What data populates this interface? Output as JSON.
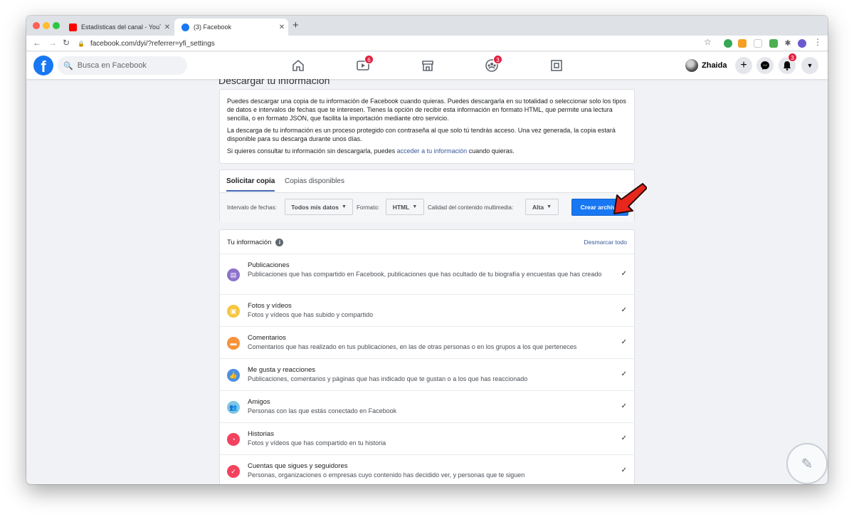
{
  "browser": {
    "tabs": [
      {
        "title": "Estadísticas del canal - YouTub",
        "close": "✕"
      },
      {
        "title": "(3) Facebook",
        "close": "✕"
      }
    ],
    "new_tab": "+",
    "url": "facebook.com/dyi/?referrer=yfi_settings"
  },
  "fb": {
    "logo": "f",
    "search_placeholder": "Busca en Facebook",
    "badges": {
      "watch": "6",
      "groups": "3",
      "notifications": "3"
    },
    "profile_name": "Zhaida",
    "plus": "+"
  },
  "page": {
    "title": "Descargar tu información",
    "intro": {
      "p1": "Puedes descargar una copia de tu información de Facebook cuando quieras. Puedes descargarla en su totalidad o seleccionar solo los tipos de datos e intervalos de fechas que te interesen. Tienes la opción de recibir esta información en formato HTML, que permite una lectura sencilla, o en formato JSON, que facilita la importación mediante otro servicio.",
      "p2": "La descarga de tu información es un proceso protegido con contraseña al que solo tú tendrás acceso. Una vez generada, la copia estará disponible para su descarga durante unos días.",
      "p3_before": "Si quieres consultar tu información sin descargarla, puedes ",
      "p3_link": "acceder a tu información",
      "p3_after": " cuando quieras."
    },
    "tabs": [
      "Solicitar copia",
      "Copias disponibles"
    ],
    "filters": {
      "range_label": "Intervalo de fechas:",
      "range_value": "Todos mis datos",
      "format_label": "Formato:",
      "format_value": "HTML",
      "quality_label": "Calidad del contenido multimedia:",
      "quality_value": "Alta"
    },
    "create_button": "Crear archivo",
    "info": {
      "title": "Tu información",
      "info_glyph": "i",
      "deselect": "Desmarcar todo",
      "items": [
        {
          "title": "Publicaciones",
          "desc": "Publicaciones que has compartido en Facebook, publicaciones que has ocultado de tu biografía y encuestas que has creado",
          "color": "#8c72cb",
          "glyph": "▤"
        },
        {
          "title": "Fotos y vídeos",
          "desc": "Fotos y vídeos que has subido y compartido",
          "color": "#f7c63f",
          "glyph": "▣"
        },
        {
          "title": "Comentarios",
          "desc": "Comentarios que has realizado en tus publicaciones, en las de otras personas o en los grupos a los que perteneces",
          "color": "#f7923a",
          "glyph": "▬"
        },
        {
          "title": "Me gusta y reacciones",
          "desc": "Publicaciones, comentarios y páginas que has indicado que te gustan o a los que has reaccionado",
          "color": "#4a90e2",
          "glyph": "👍"
        },
        {
          "title": "Amigos",
          "desc": "Personas con las que estás conectado en Facebook",
          "color": "#7fc6e4",
          "glyph": "👥"
        },
        {
          "title": "Historias",
          "desc": "Fotos y vídeos que has compartido en tu historia",
          "color": "#f3425f",
          "glyph": "◔"
        },
        {
          "title": "Cuentas que sigues y seguidores",
          "desc": "Personas, organizaciones o empresas cuyo contenido has decidido ver, y personas que te siguen",
          "color": "#f3425f",
          "glyph": "✓"
        }
      ],
      "check": "✓"
    }
  },
  "colors": {
    "fb_blue": "#1877f2",
    "link": "#385898",
    "arrow": "#e8271c"
  }
}
